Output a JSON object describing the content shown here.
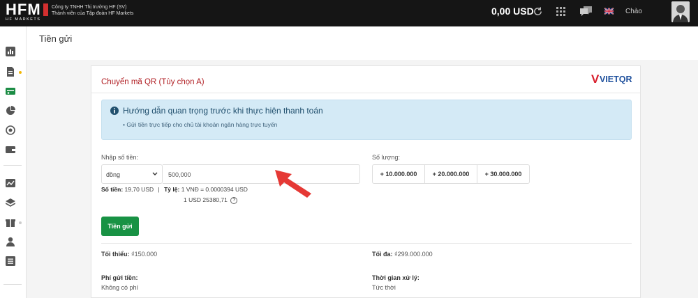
{
  "header": {
    "logo_text": "HFM",
    "logo_sub": "HF MARKETS",
    "company_line1": "Công ty TNHH Thị trường HF (SV)",
    "company_line2": "Thành viên của Tập đoàn HF Markets",
    "balance": "0,00 USD",
    "greeting": "Chào"
  },
  "sidebar": {
    "items": [
      "chart-bar-icon",
      "document-icon",
      "deposit-icon",
      "piggy-bank-icon",
      "transfer-icon",
      "wallet-icon",
      "analytics-icon",
      "layers-icon",
      "gift-icon",
      "user-icon",
      "list-icon"
    ]
  },
  "page": {
    "title": "Tiền gửi"
  },
  "card": {
    "title": "Chuyển mã QR (Tùy chọn A)",
    "brand_logo": "VIETQR",
    "alert": {
      "title": "Hướng dẫn quan trọng trước khi thực hiện thanh toán",
      "items": [
        "Gửi tiền trực tiếp cho chủ tài khoản ngân hàng trực tuyến"
      ]
    },
    "amount_label": "Nhập số tiền:",
    "currency_selected": "đồng",
    "amount_value": "500,000",
    "quantity_label": "Số lượng:",
    "quick_amounts": [
      "+ 10.000.000",
      "+ 20.000.000",
      "+ 30.000.000"
    ],
    "sum_label": "Số tiền:",
    "sum_value": "19,70 USD",
    "separator": "|",
    "rate_label": "Tỷ lệ:",
    "rate_line1": "1 VNĐ = 0.0000394 USD",
    "rate_line2": "1 USD 25380,71",
    "help_glyph": "?",
    "deposit_button": "Tiền gửi",
    "min_label": "Tối thiểu:",
    "min_value": "₫150.000",
    "max_label": "Tối đa:",
    "max_value": "₫299.000.000",
    "fee_label": "Phí gửi tiền:",
    "fee_value": "Không có phí",
    "time_label": "Thời gian xử lý:",
    "time_value": "Tức thời"
  },
  "colors": {
    "accent_red": "#b11f24",
    "button_green": "#189244",
    "alert_bg": "#d4eaf6",
    "arrow_red": "#e53935"
  }
}
